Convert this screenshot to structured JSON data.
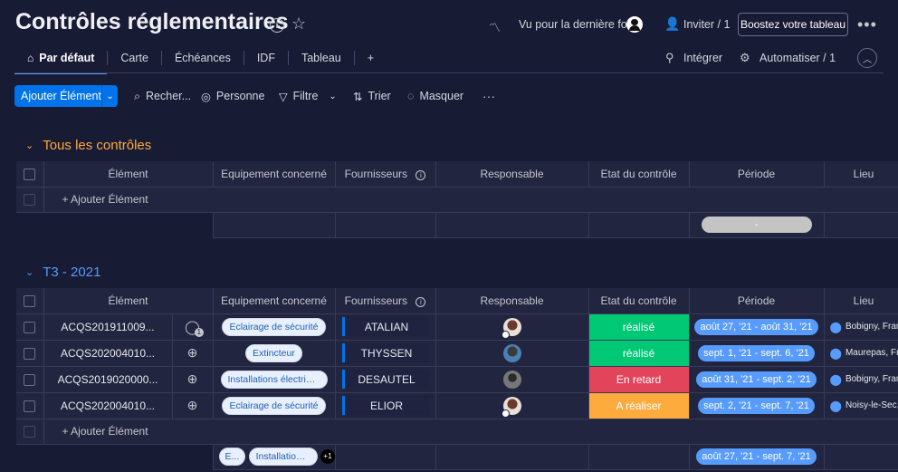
{
  "board": {
    "title": "Contrôles réglementaires"
  },
  "header": {
    "last_seen": "Vu pour la dernière fois",
    "invite": "Inviter / 1",
    "boost": "Boostez votre tableau",
    "integrate": "Intégrer",
    "automate": "Automatiser / 1"
  },
  "tabs": [
    {
      "label": "Par défaut"
    },
    {
      "label": "Carte"
    },
    {
      "label": "Échéances"
    },
    {
      "label": "IDF"
    },
    {
      "label": "Tableau"
    },
    {
      "label": "+"
    }
  ],
  "toolbar": {
    "add_item": "Ajouter Élément",
    "search": "Recher...",
    "person": "Personne",
    "filter": "Filtre",
    "sort": "Trier",
    "hide": "Masquer"
  },
  "columns": [
    "Élément",
    "Equipement concerné",
    "Fournisseurs",
    "Responsable",
    "Etat du contrôle",
    "Période",
    "Lieu"
  ],
  "colors": {
    "accent": "#0073ea",
    "group1": "#fdab3d",
    "group2": "#579bfc",
    "done": "#00c875",
    "late": "#e2445c",
    "todo": "#fdab3d",
    "date": "#579bfc"
  },
  "groups": [
    {
      "title": "Tous les contrôles",
      "add_item": "+ Ajouter Élément",
      "summary_period": "-"
    },
    {
      "title": "T3 - 2021",
      "add_item": "+ Ajouter Élément",
      "rows": [
        {
          "element": "ACQS201911009...",
          "update_count": "1",
          "equipment": "Eclairage de sécurité",
          "supplier": "ATALIAN",
          "status": "réalisé",
          "status_color": "#00c875",
          "period": "août 27, '21 - août 31, '21",
          "location": "Bobigny, Fran"
        },
        {
          "element": "ACQS202004010...",
          "update_count": "",
          "equipment": "Extincteur",
          "supplier": "THYSSEN",
          "status": "réalisé",
          "status_color": "#00c875",
          "period": "sept. 1, '21 - sept. 6, '21",
          "location": "Maurepas, Fr"
        },
        {
          "element": "ACQS2019020000...",
          "update_count": "",
          "equipment": "Installations électrique...",
          "supplier": "DESAUTEL",
          "status": "En retard",
          "status_color": "#e2445c",
          "period": "août 31, '21 - sept. 2, '21",
          "location": "Bobigny, Fran"
        },
        {
          "element": "ACQS202004010...",
          "update_count": "",
          "equipment": "Eclairage de sécurité",
          "supplier": "ELIOR",
          "status": "A réaliser",
          "status_color": "#fdab3d",
          "period": "sept. 2, '21 - sept. 7, '21",
          "location": "Noisy-le-Sec,"
        }
      ],
      "summary": {
        "equip_a": "E...",
        "equip_b": "Installations é...",
        "more": "+1",
        "period": "août 27, '21 - sept. 7, '21"
      }
    }
  ]
}
